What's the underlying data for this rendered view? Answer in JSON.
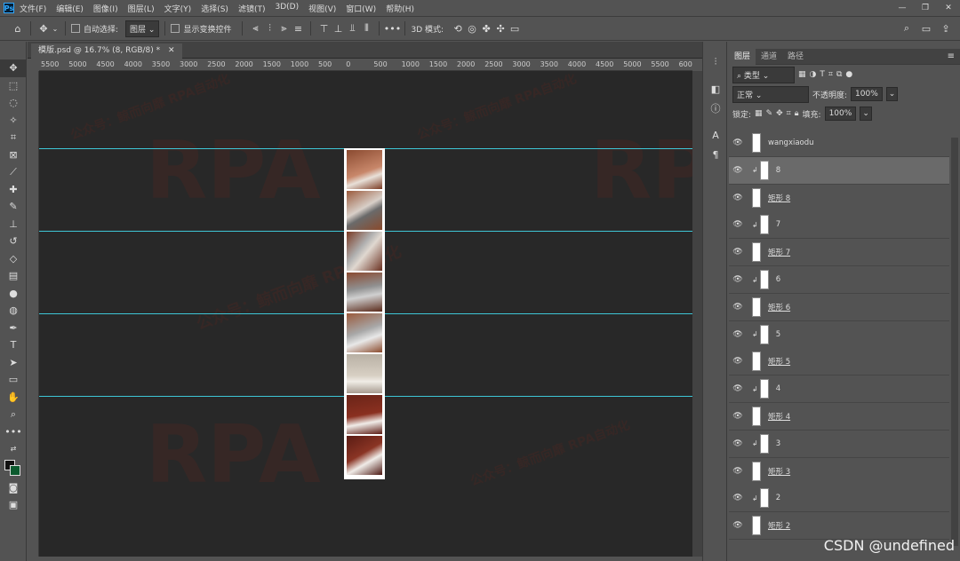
{
  "menu": {
    "logo": "Ps",
    "items": [
      "文件(F)",
      "编辑(E)",
      "图像(I)",
      "图层(L)",
      "文字(Y)",
      "选择(S)",
      "滤镜(T)",
      "3D(D)",
      "视图(V)",
      "窗口(W)",
      "帮助(H)"
    ],
    "window_controls": [
      "—",
      "❐",
      "✕"
    ]
  },
  "options": {
    "auto_select_label": "自动选择:",
    "auto_select_value": "图层",
    "show_transform_label": "显示变换控件",
    "mode_3d_label": "3D 模式:"
  },
  "document": {
    "tab_title": "模版.psd @ 16.7% (8, RGB/8) *",
    "close": "✕"
  },
  "ruler_top": [
    "5500",
    "5000",
    "4500",
    "4000",
    "3500",
    "3000",
    "2500",
    "2000",
    "1500",
    "1000",
    "500",
    "0",
    "500",
    "1000",
    "1500",
    "2000",
    "2500",
    "3000",
    "3500",
    "4000",
    "4500",
    "5000",
    "5500",
    "600"
  ],
  "watermarks": {
    "rpa": "RPA",
    "zh": "公众号：鲸而向靡 RPA自动化"
  },
  "panel": {
    "tabs": [
      "图层",
      "通道",
      "路径"
    ],
    "filter_label": "类型",
    "blend_mode": "正常",
    "opacity_label": "不透明度:",
    "opacity_value": "100%",
    "lock_label": "锁定:",
    "fill_label": "填充:",
    "fill_value": "100%"
  },
  "layers": [
    {
      "name": "wangxiaodu",
      "type": "plain",
      "selected": false
    },
    {
      "name": "8",
      "type": "clip",
      "selected": true
    },
    {
      "name": "矩形 8",
      "type": "shape",
      "selected": false
    },
    {
      "name": "7",
      "type": "clip",
      "selected": false
    },
    {
      "name": "矩形 7",
      "type": "shape",
      "selected": false
    },
    {
      "name": "6",
      "type": "clip",
      "selected": false
    },
    {
      "name": "矩形 6",
      "type": "shape",
      "selected": false
    },
    {
      "name": "5",
      "type": "clip",
      "selected": false
    },
    {
      "name": "矩形 5",
      "type": "shape",
      "selected": false
    },
    {
      "name": "4",
      "type": "clip",
      "selected": false
    },
    {
      "name": "矩形 4",
      "type": "shape",
      "selected": false
    },
    {
      "name": "3",
      "type": "clip",
      "selected": false
    },
    {
      "name": "矩形 3",
      "type": "shape",
      "selected": false
    },
    {
      "name": "2",
      "type": "clip",
      "selected": false
    },
    {
      "name": "矩形 2",
      "type": "shape",
      "selected": false
    }
  ],
  "credit": "CSDN @undefined",
  "colors": {
    "guide": "#3ec6d6",
    "canvas_bg": "#282828",
    "ui_bg": "#535353"
  }
}
